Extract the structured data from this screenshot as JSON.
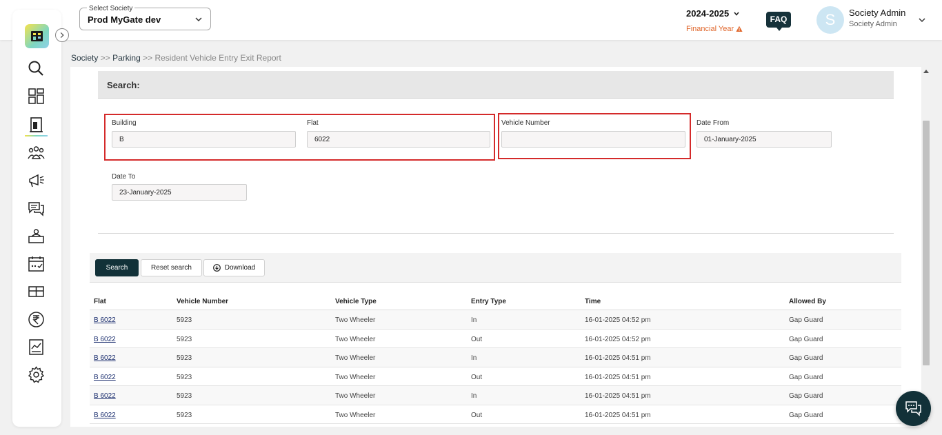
{
  "header": {
    "society_label": "Select Society",
    "society_value": "Prod MyGate dev",
    "financial_year": "2024-2025",
    "financial_year_label": "Financial Year",
    "faq_label": "FAQ",
    "user_initial": "S",
    "user_name": "Society Admin",
    "user_role": "Society Admin"
  },
  "sidebar": {
    "items": [
      "search-icon",
      "dashboard-icon",
      "parking-icon",
      "residents-icon",
      "announcement-icon",
      "chat-icon",
      "helpdesk-icon",
      "calendar-icon",
      "amenities-icon",
      "rupee-icon",
      "reports-icon",
      "settings-icon"
    ],
    "active": "parking-icon"
  },
  "breadcrumb": {
    "society": "Society",
    "sep1": ">>",
    "parking": "Parking",
    "sep2": ">>",
    "current": "Resident Vehicle Entry Exit Report"
  },
  "search": {
    "title": "Search:",
    "building_label": "Building",
    "building_value": "B",
    "flat_label": "Flat",
    "flat_value": "6022",
    "vehicle_label": "Vehicle Number",
    "vehicle_value": "",
    "date_from_label": "Date From",
    "date_from_value": "01-January-2025",
    "date_to_label": "Date To",
    "date_to_value": "23-January-2025"
  },
  "actions": {
    "search": "Search",
    "reset": "Reset search",
    "download": "Download"
  },
  "table": {
    "columns": [
      "Flat",
      "Vehicle Number",
      "Vehicle Type",
      "Entry Type",
      "Time",
      "Allowed By"
    ],
    "rows": [
      [
        "B 6022",
        "5923",
        "Two Wheeler",
        "In",
        "16-01-2025 04:52 pm",
        "Gap Guard"
      ],
      [
        "B 6022",
        "5923",
        "Two Wheeler",
        "Out",
        "16-01-2025 04:52 pm",
        "Gap Guard"
      ],
      [
        "B 6022",
        "5923",
        "Two Wheeler",
        "In",
        "16-01-2025 04:51 pm",
        "Gap Guard"
      ],
      [
        "B 6022",
        "5923",
        "Two Wheeler",
        "Out",
        "16-01-2025 04:51 pm",
        "Gap Guard"
      ],
      [
        "B 6022",
        "5923",
        "Two Wheeler",
        "In",
        "16-01-2025 04:51 pm",
        "Gap Guard"
      ],
      [
        "B 6022",
        "5923",
        "Two Wheeler",
        "Out",
        "16-01-2025 04:51 pm",
        "Gap Guard"
      ]
    ]
  },
  "colors": {
    "primary_dark": "#123138",
    "highlight_red": "#d42a2a",
    "fy_orange": "#e0662b"
  }
}
